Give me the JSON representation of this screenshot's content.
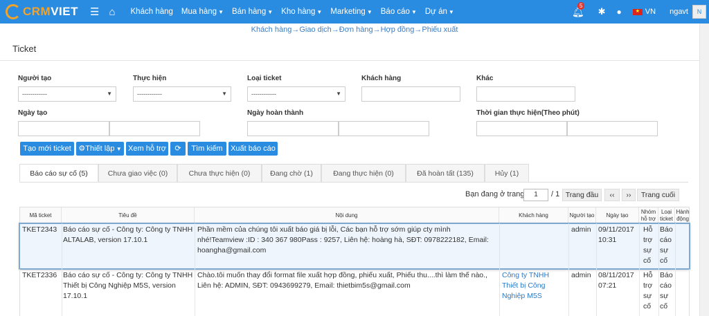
{
  "brand": {
    "part1": "CRM",
    "part2": "VIET"
  },
  "nav": {
    "items": [
      {
        "label": "Khách hàng",
        "caret": false
      },
      {
        "label": "Mua hàng",
        "caret": true
      },
      {
        "label": "Bán hàng",
        "caret": true
      },
      {
        "label": "Kho hàng",
        "caret": true
      },
      {
        "label": "Marketing",
        "caret": true
      },
      {
        "label": "Báo cáo",
        "caret": true
      },
      {
        "label": "Dự án",
        "caret": true
      }
    ],
    "notification_count": "5",
    "language": "VN",
    "username": "ngavt",
    "avatar_alt": "N"
  },
  "breadcrumb": "Khách hàng→Giao dịch→Đơn hàng→Hợp đồng→Phiếu xuất",
  "page_title": "Ticket",
  "filters": {
    "nguoi_tao": {
      "label": "Người tạo",
      "value": "------------"
    },
    "thuc_hien": {
      "label": "Thực hiện",
      "value": "------------"
    },
    "loai_ticket": {
      "label": "Loại ticket",
      "value": "------------"
    },
    "khach_hang": {
      "label": "Khách hàng",
      "value": ""
    },
    "khac": {
      "label": "Khác",
      "value": ""
    },
    "ngay_tao": {
      "label": "Ngày tạo"
    },
    "ngay_hoan_thanh": {
      "label": "Ngày hoàn thành"
    },
    "thoi_gian": {
      "label": "Thời gian thực hiện(Theo phút)"
    }
  },
  "buttons": {
    "create": "Tạo mới ticket",
    "setup": "Thiết lập",
    "support": "Xem hỗ trợ",
    "refresh": "⟳",
    "search": "Tìm kiếm",
    "export": "Xuất báo cáo"
  },
  "tabs": [
    {
      "label": "Báo cáo sự cố (5)",
      "active": true
    },
    {
      "label": "Chưa giao việc (0)",
      "active": false
    },
    {
      "label": "Chưa thực hiện (0)",
      "active": false
    },
    {
      "label": "Đang chờ (1)",
      "active": false
    },
    {
      "label": "Đang thực hiện (0)",
      "active": false
    },
    {
      "label": "Đã hoàn tất (135)",
      "active": false
    },
    {
      "label": "Hủy (1)",
      "active": false
    }
  ],
  "pager": {
    "label": "Bạn đang ở trang",
    "current": "1",
    "total": "/ 1",
    "first": "Trang đầu",
    "prev": "‹‹",
    "next": "››",
    "last": "Trang cuối"
  },
  "table": {
    "headers": {
      "ma": "Mã ticket",
      "tieude": "Tiêu đề",
      "noidung": "Nội dung",
      "khachhang": "Khách hàng",
      "nguoitao": "Người tạo",
      "ngaytao": "Ngày tạo",
      "nhom": "Nhóm hỗ trợ",
      "loai": "Loại ticket",
      "hanhdong": "Hành động"
    },
    "rows": [
      {
        "ma": "TKET2343",
        "tieude": "Báo cáo sự cố - Công ty: Công ty TNHH ALTALAB, version 17.10.1",
        "noidung": "Phần mềm của chúng tôi xuất báo giá bị lỗi, Các bạn hỗ trợ sớm giúp cty mình nhé!Teamview :ID : 340 367 980Pass : 9257, Liên hệ: hoàng hà, SĐT: 0978222182, Email: hoangha@gmail.com",
        "khachhang": "",
        "nguoitao": "admin",
        "ngaytao": "09/11/2017 10:31",
        "nhom": "Hỗ trợ sự cố",
        "loai": "Báo cáo sự cố"
      },
      {
        "ma": "TKET2336",
        "tieude": "Báo cáo sự cố - Công ty: Công ty TNHH Thiết bị Công Nghiệp M5S, version 17.10.1",
        "noidung": "Chào.tôi muốn thay đổi format file xuất hợp đồng, phiếu xuất, Phiếu thu....thì làm thế nào., Liên hệ: ADMIN, SĐT: 0943699279, Email: thietbim5s@gmail.com",
        "khachhang": "Công ty TNHH Thiết bị Công Nghiệp M5S",
        "nguoitao": "admin",
        "ngaytao": "08/11/2017 07:21",
        "nhom": "Hỗ trợ sự cố",
        "loai": "Báo cáo sự cố"
      }
    ]
  }
}
